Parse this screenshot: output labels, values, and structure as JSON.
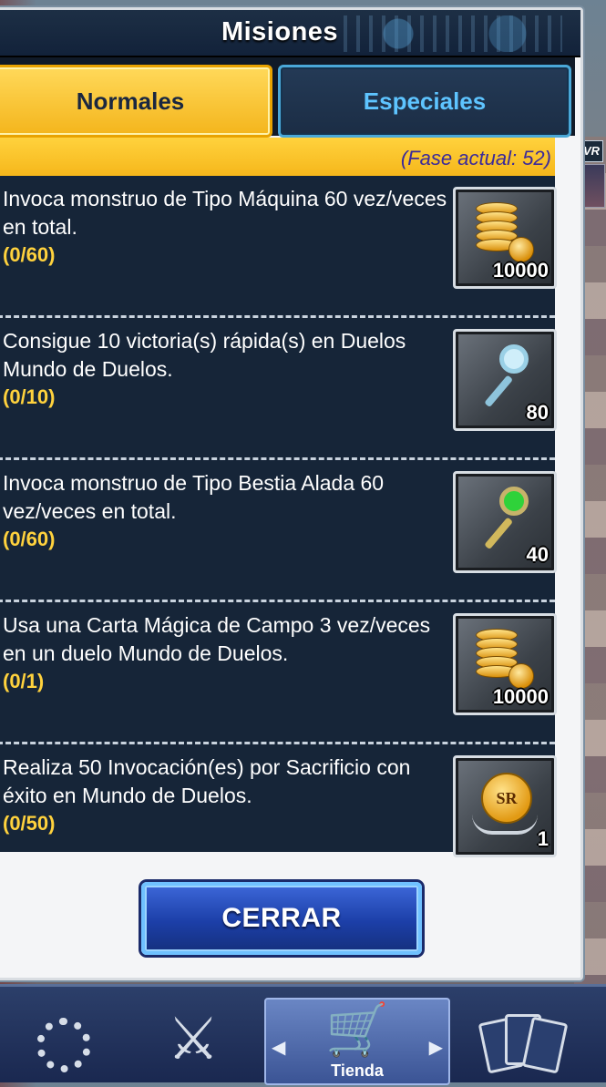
{
  "dialog": {
    "title": "Misiones",
    "tabs": [
      {
        "label": "Normales",
        "active": true
      },
      {
        "label": "Especiales",
        "active": false
      }
    ],
    "phase_label": "(Fase actual: 52)",
    "close_label": "CERRAR"
  },
  "missions": [
    {
      "description": "Invoca monstruo de Tipo Máquina 60 vez/veces en total.",
      "progress": "(0/60)",
      "reward": {
        "icon": "gold-coins-icon",
        "quantity": "10000"
      }
    },
    {
      "description": "Consigue 10 victoria(s) rápida(s) en Duelos Mundo de Duelos.",
      "progress": "(0/10)",
      "reward": {
        "icon": "blue-key-icon",
        "quantity": "80"
      }
    },
    {
      "description": "Invoca monstruo de Tipo Bestia Alada 60 vez/veces en total.",
      "progress": "(0/60)",
      "reward": {
        "icon": "green-key-icon",
        "quantity": "40"
      }
    },
    {
      "description": "Usa una Carta Mágica de Campo 3 vez/veces en un duelo Mundo de Duelos.",
      "progress": "(0/1)",
      "reward": {
        "icon": "gold-coins-icon",
        "quantity": "10000"
      }
    },
    {
      "description": "Realiza 50 Invocación(es) por Sacrificio con éxito en Mundo de Duelos.",
      "progress": "(0/50)",
      "reward": {
        "icon": "sr-ticket-icon",
        "quantity": "1",
        "medal_text": "SR"
      }
    }
  ],
  "background": {
    "badge": "VR"
  },
  "bottom_nav": {
    "shop_label": "Tienda"
  },
  "colors": {
    "accent_yellow": "#f6b71b",
    "panel_dark": "#162538",
    "tab_blue": "#5ec4ff",
    "progress_yellow": "#ffd23d",
    "button_blue": "#1c3fa8"
  }
}
